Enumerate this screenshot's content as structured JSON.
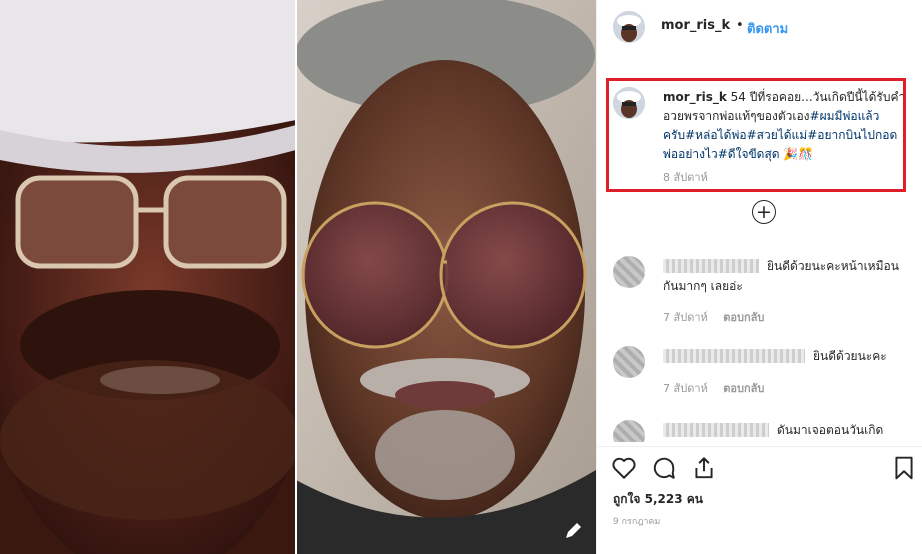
{
  "post": {
    "username": "mor_ris_k",
    "separator": "•",
    "follow_label": "ติดตาม",
    "caption": {
      "username": "mor_ris_k",
      "text": "54 ปีที่รอคอย...วันเกิดปีนี้ได้รับคำอวยพรจากพ่อแท้ๆของตัวเอง",
      "tags": [
        "#ผมมีพ่อแล้วครับ",
        "#หล่อได้พ่อ",
        "#สวยได้แม่",
        "#อยากบินไปกอดพ่ออย่างไว",
        "#ดีใจขีดสุด"
      ],
      "emoji": "🎉🎊",
      "time": "8 สัปดาห์"
    },
    "comments": [
      {
        "text": "ยินดีด้วยนะคะหน้าเหมือนกันมากๆ เลยอ่ะ",
        "time": "7 สัปดาห์",
        "reply": "ตอบกลับ"
      },
      {
        "text": "ยินดีด้วยนะคะ",
        "time": "7 สัปดาห์",
        "reply": "ตอบกลับ"
      },
      {
        "text": "ดันมาเจอตอนวันเกิด",
        "time": "",
        "reply": ""
      }
    ],
    "likes": "ถูกใจ 5,223 คน",
    "date": "9 กรกฎาคม"
  },
  "icons": {
    "heart": "heart-icon",
    "comment": "comment-icon",
    "share": "share-icon",
    "bookmark": "bookmark-icon",
    "load_more": "plus-circle-icon",
    "edit": "pencil-icon"
  },
  "colors": {
    "link": "#3897f0",
    "highlight": "#e01e2a",
    "hashtag": "#003569"
  }
}
